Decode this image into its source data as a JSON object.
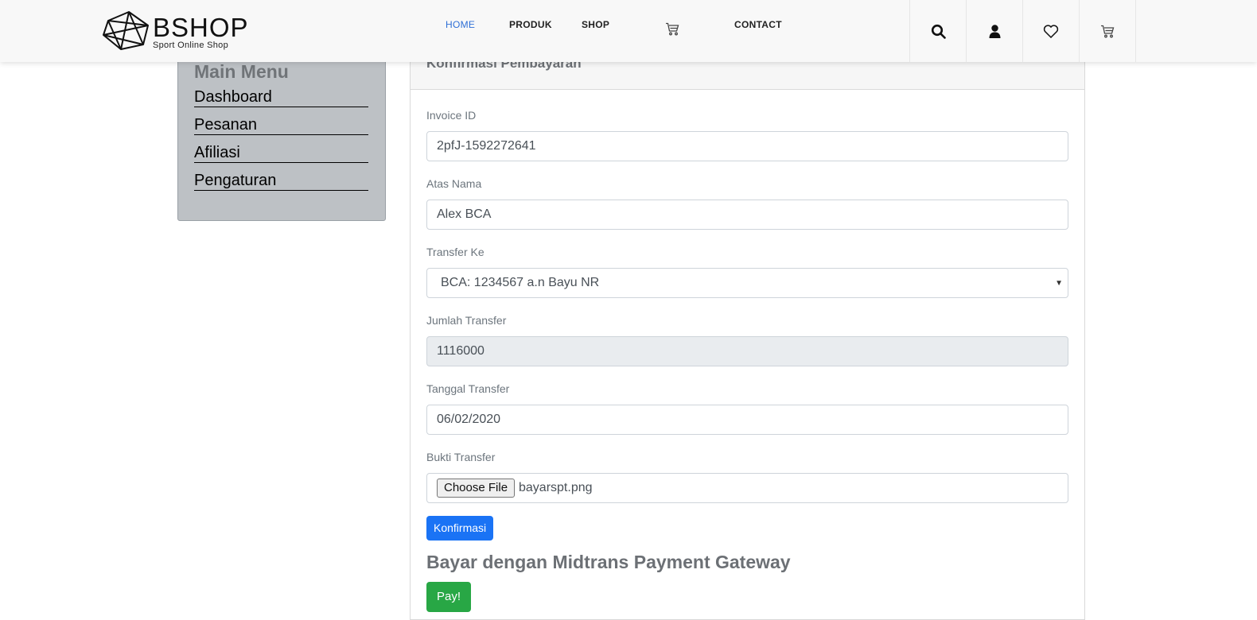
{
  "header": {
    "logo_name": "BSHOP",
    "logo_tagline": "Sport Online Shop",
    "nav": [
      {
        "label": "HOME",
        "active": true
      },
      {
        "label": "PRODUK",
        "active": false
      },
      {
        "label": "SHOP",
        "active": false
      },
      {
        "label": "CONTACT",
        "active": false
      }
    ],
    "nav_cart_icon": "cart-icon",
    "icons": [
      "search-icon",
      "user-icon",
      "heart-icon",
      "cart-icon"
    ],
    "accent_color": "#2f6fd6"
  },
  "sidebar": {
    "title": "Main Menu",
    "items": [
      "Dashboard",
      "Pesanan",
      "Afiliasi",
      "Pengaturan"
    ]
  },
  "card": {
    "title": "Konfirmasi Pembayaran"
  },
  "form": {
    "invoice": {
      "label": "Invoice ID",
      "value": "2pfJ-1592272641"
    },
    "name": {
      "label": "Atas Nama",
      "value": "Alex BCA"
    },
    "transfer_to": {
      "label": "Transfer Ke",
      "value": "BCA: 1234567 a.n Bayu NR"
    },
    "amount": {
      "label": "Jumlah Transfer",
      "value": "1116000"
    },
    "date": {
      "label": "Tanggal Transfer",
      "value": "06/02/2020"
    },
    "proof": {
      "label": "Bukti Transfer",
      "button": "Choose File",
      "file": "bayarspt.png"
    },
    "submit": "Konfirmasi"
  },
  "midtrans": {
    "title": "Bayar dengan Midtrans Payment Gateway",
    "pay_button": "Pay!"
  },
  "colors": {
    "primary": "#1a73f5",
    "success": "#28a745",
    "sidebar_bg": "#bdc1c5"
  }
}
